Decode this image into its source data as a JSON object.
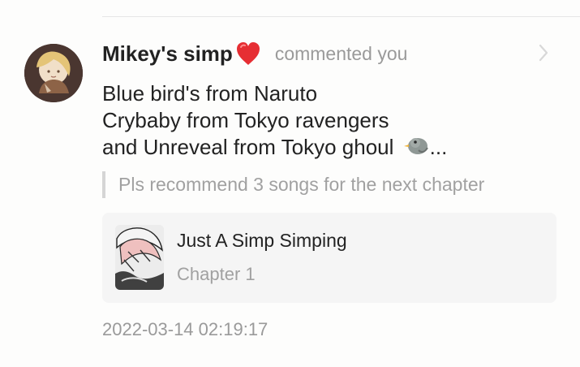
{
  "notification": {
    "user": {
      "name": "Mikey's simp",
      "avatar_icon": "avatar-anime-character",
      "name_emoji": "red-heart"
    },
    "action_text": "commented you",
    "comment_lines": [
      "Blue bird's from Naruto",
      "Crybaby from Tokyo ravengers",
      "and Unreveal from Tokyo ghoul"
    ],
    "comment_emoji": "bird",
    "comment_ellipsis": "...",
    "quote": "Pls recommend 3 songs for the next chapter",
    "story": {
      "title": "Just A Simp Simping",
      "chapter": "Chapter 1",
      "cover_icon": "story-cover"
    },
    "timestamp": "2022-03-14 02:19:17",
    "navigation_icon": "chevron-right-icon"
  }
}
